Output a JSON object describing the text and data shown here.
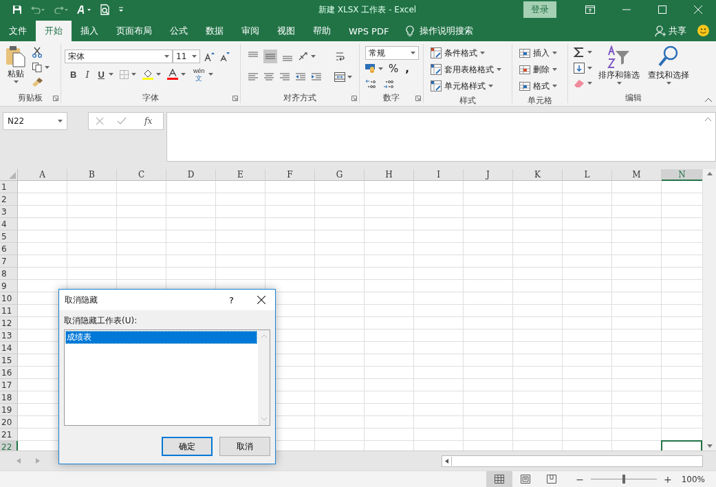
{
  "title_bar": {
    "title": "新建 XLSX 工作表  -  Excel",
    "login": "登录"
  },
  "tabs": [
    {
      "label": "文件",
      "selected": false
    },
    {
      "label": "开始",
      "selected": true
    },
    {
      "label": "插入",
      "selected": false
    },
    {
      "label": "页面布局",
      "selected": false
    },
    {
      "label": "公式",
      "selected": false
    },
    {
      "label": "数据",
      "selected": false
    },
    {
      "label": "审阅",
      "selected": false
    },
    {
      "label": "视图",
      "selected": false
    },
    {
      "label": "帮助",
      "selected": false
    },
    {
      "label": "WPS PDF",
      "selected": false
    }
  ],
  "tell_me": "操作说明搜索",
  "share": "共享",
  "ribbon": {
    "clipboard": {
      "label": "剪贴板",
      "paste": "粘贴"
    },
    "font": {
      "label": "字体",
      "font_name": "宋体",
      "font_size": "11",
      "bold": "B",
      "italic": "I",
      "underline": "U",
      "phonetic_top": "wén",
      "phonetic_bottom": "文"
    },
    "alignment": {
      "label": "对齐方式"
    },
    "number": {
      "label": "数字",
      "format": "常规",
      "percent": "%",
      "comma": ","
    },
    "styles": {
      "label": "样式",
      "items": [
        "条件格式",
        "套用表格格式",
        "单元格样式"
      ]
    },
    "cells": {
      "label": "单元格",
      "items": [
        "插入",
        "删除",
        "格式"
      ]
    },
    "editing": {
      "label": "编辑",
      "sort": "排序和筛选",
      "find": "查找和选择"
    }
  },
  "formula_bar": {
    "name_box": "N22",
    "function_button": "fx"
  },
  "sheet": {
    "columns": [
      {
        "label": "A",
        "selected": false
      },
      {
        "label": "B",
        "selected": false
      },
      {
        "label": "C",
        "selected": false
      },
      {
        "label": "D",
        "selected": false
      },
      {
        "label": "E",
        "selected": false
      },
      {
        "label": "F",
        "selected": false
      },
      {
        "label": "G",
        "selected": false
      },
      {
        "label": "H",
        "selected": false
      },
      {
        "label": "I",
        "selected": false
      },
      {
        "label": "J",
        "selected": false
      },
      {
        "label": "K",
        "selected": false
      },
      {
        "label": "L",
        "selected": false
      },
      {
        "label": "M",
        "selected": false
      },
      {
        "label": "N",
        "selected": true
      }
    ],
    "rows": [
      {
        "label": "1",
        "selected": false
      },
      {
        "label": "2",
        "selected": false
      },
      {
        "label": "3",
        "selected": false
      },
      {
        "label": "4",
        "selected": false
      },
      {
        "label": "5",
        "selected": false
      },
      {
        "label": "6",
        "selected": false
      },
      {
        "label": "7",
        "selected": false
      },
      {
        "label": "8",
        "selected": false
      },
      {
        "label": "9",
        "selected": false
      },
      {
        "label": "10",
        "selected": false
      },
      {
        "label": "11",
        "selected": false
      },
      {
        "label": "12",
        "selected": false
      },
      {
        "label": "13",
        "selected": false
      },
      {
        "label": "14",
        "selected": false
      },
      {
        "label": "15",
        "selected": false
      },
      {
        "label": "16",
        "selected": false
      },
      {
        "label": "17",
        "selected": false
      },
      {
        "label": "18",
        "selected": false
      },
      {
        "label": "19",
        "selected": false
      },
      {
        "label": "20",
        "selected": false
      },
      {
        "label": "21",
        "selected": false
      },
      {
        "label": "22",
        "selected": true
      }
    ]
  },
  "dialog": {
    "title": "取消隐藏",
    "help": "?",
    "label": "取消隐藏工作表(U):",
    "items": [
      {
        "label": "成绩表",
        "selected": true
      }
    ],
    "buttons": [
      {
        "label": "确定",
        "default": true
      },
      {
        "label": "取消",
        "default": false
      }
    ]
  },
  "status_bar": {
    "views": [
      {
        "kind": "normal",
        "selected": true
      },
      {
        "kind": "page_layout",
        "selected": false
      },
      {
        "kind": "page_break",
        "selected": false
      }
    ],
    "zoom_out": "−",
    "zoom_in": "+",
    "zoom": {
      "level": 0.5,
      "reading": "100%"
    }
  }
}
